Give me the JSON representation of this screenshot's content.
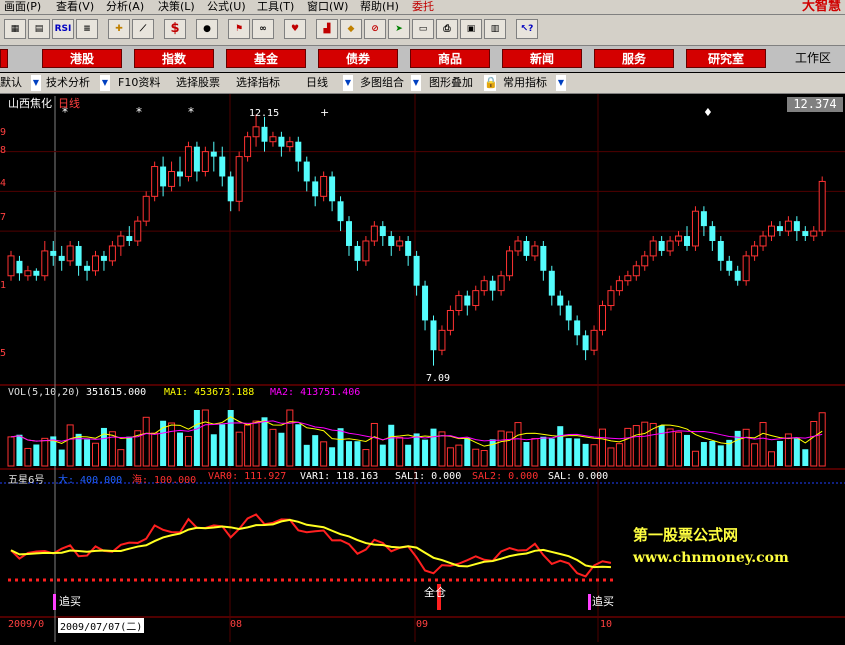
{
  "menu": [
    {
      "label": "画面(P)"
    },
    {
      "label": "查看(V)"
    },
    {
      "label": "分析(A)"
    },
    {
      "label": "决策(L)"
    },
    {
      "label": "公式(U)"
    },
    {
      "label": "工具(T)"
    },
    {
      "label": "窗口(W)"
    },
    {
      "label": "帮助(H)"
    },
    {
      "label": "委托"
    }
  ],
  "brand": "大智慧",
  "toolbar": {
    "rsi_label": "RSI",
    "dollar_label": "$"
  },
  "nav": [
    {
      "label": "港股"
    },
    {
      "label": "指数"
    },
    {
      "label": "基金"
    },
    {
      "label": "债券"
    },
    {
      "label": "商品"
    },
    {
      "label": "新闻"
    },
    {
      "label": "服务"
    },
    {
      "label": "研究室"
    }
  ],
  "workarea": "工作区",
  "subnav": [
    {
      "label": "默认"
    },
    {
      "label": "技术分析"
    },
    {
      "label": "F10资料"
    },
    {
      "label": "选择股票"
    },
    {
      "label": "选择指标"
    },
    {
      "label": "日线"
    },
    {
      "label": "多图组合"
    },
    {
      "label": "图形叠加"
    },
    {
      "label": "常用指标"
    }
  ],
  "colors": {
    "up": "#ff3232",
    "down": "#54fcfc",
    "accent": "#d40000",
    "ma1": "#ffff00",
    "ma2": "#ff00ff"
  },
  "stock": {
    "name": "山西焦化",
    "period": "日线",
    "current_price": "12.374"
  },
  "price_axis": [
    "9",
    "8",
    "4",
    "7",
    "1",
    "5"
  ],
  "high_label": "12.15",
  "low_label": "7.09",
  "vol_header": {
    "title": "VOL(5,10,20)",
    "value": "351615.000",
    "ma1": "MA1: 453673.188",
    "ma2": "MA2: 413751.406"
  },
  "ind_header": {
    "title": "五星6号",
    "big": "大: 400.000",
    "sea": "海: 100.000",
    "var0": "VAR0: 111.927",
    "var1": "VAR1: 118.163",
    "sal1": "SAL1: 0.000",
    "sal2": "SAL2: 0.000",
    "sal": "SAL: 0.000"
  },
  "signals": [
    "追买",
    "全仓",
    "追买"
  ],
  "watermark": {
    "line1": "第一股票公式网",
    "line2": "www.chnmoney.com"
  },
  "date_axis": {
    "left": "2009/0",
    "cursor": "2009/07/07(二)",
    "ticks": [
      "08",
      "09",
      "10"
    ]
  },
  "chart_data": {
    "type": "candlestick",
    "high": 12.15,
    "low": 7.09,
    "current": 12.374,
    "candles": [
      [
        8.9,
        9.3,
        8.8,
        9.4
      ],
      [
        9.2,
        8.95,
        8.8,
        9.3
      ],
      [
        8.9,
        9.0,
        8.8,
        9.1
      ],
      [
        9.0,
        8.9,
        8.8,
        9.05
      ],
      [
        8.9,
        9.4,
        8.8,
        9.6
      ],
      [
        9.4,
        9.3,
        9.1,
        9.6
      ],
      [
        9.3,
        9.2,
        9.0,
        9.5
      ],
      [
        9.2,
        9.5,
        9.1,
        9.6
      ],
      [
        9.5,
        9.1,
        8.9,
        9.6
      ],
      [
        9.1,
        9.0,
        8.8,
        9.2
      ],
      [
        9.0,
        9.3,
        8.9,
        9.4
      ],
      [
        9.3,
        9.2,
        9.0,
        9.4
      ],
      [
        9.2,
        9.5,
        9.1,
        9.6
      ],
      [
        9.5,
        9.7,
        9.3,
        9.8
      ],
      [
        9.7,
        9.6,
        9.5,
        9.9
      ],
      [
        9.6,
        10.0,
        9.5,
        10.1
      ],
      [
        10.0,
        10.5,
        9.9,
        10.6
      ],
      [
        10.5,
        11.1,
        10.4,
        11.2
      ],
      [
        11.1,
        10.7,
        10.5,
        11.3
      ],
      [
        10.7,
        11.0,
        10.6,
        11.2
      ],
      [
        11.0,
        10.9,
        10.7,
        11.3
      ],
      [
        10.9,
        11.5,
        10.8,
        11.6
      ],
      [
        11.5,
        11.0,
        10.8,
        11.6
      ],
      [
        11.0,
        11.4,
        10.9,
        11.5
      ],
      [
        11.4,
        11.3,
        11.0,
        11.6
      ],
      [
        11.3,
        10.9,
        10.7,
        11.5
      ],
      [
        10.9,
        10.4,
        10.2,
        11.0
      ],
      [
        10.4,
        11.3,
        10.2,
        11.4
      ],
      [
        11.3,
        11.7,
        11.2,
        11.8
      ],
      [
        11.7,
        11.9,
        11.5,
        12.15
      ],
      [
        11.9,
        11.6,
        11.4,
        12.1
      ],
      [
        11.6,
        11.7,
        11.5,
        11.8
      ],
      [
        11.7,
        11.5,
        11.3,
        11.8
      ],
      [
        11.5,
        11.6,
        11.4,
        11.7
      ],
      [
        11.6,
        11.2,
        11.0,
        11.7
      ],
      [
        11.2,
        10.8,
        10.6,
        11.3
      ],
      [
        10.8,
        10.5,
        10.3,
        10.9
      ],
      [
        10.5,
        10.9,
        10.4,
        11.0
      ],
      [
        10.9,
        10.4,
        10.2,
        11.0
      ],
      [
        10.4,
        10.0,
        9.8,
        10.5
      ],
      [
        10.0,
        9.5,
        9.3,
        10.1
      ],
      [
        9.5,
        9.2,
        9.0,
        9.6
      ],
      [
        9.2,
        9.6,
        9.1,
        9.7
      ],
      [
        9.6,
        9.9,
        9.5,
        10.0
      ],
      [
        9.9,
        9.7,
        9.5,
        10.0
      ],
      [
        9.7,
        9.5,
        9.3,
        9.8
      ],
      [
        9.5,
        9.6,
        9.4,
        9.7
      ],
      [
        9.6,
        9.3,
        9.1,
        9.7
      ],
      [
        9.3,
        8.7,
        8.5,
        9.4
      ],
      [
        8.7,
        8.0,
        7.8,
        8.8
      ],
      [
        8.0,
        7.4,
        7.09,
        8.1
      ],
      [
        7.4,
        7.8,
        7.3,
        7.9
      ],
      [
        7.8,
        8.2,
        7.7,
        8.3
      ],
      [
        8.2,
        8.5,
        8.1,
        8.6
      ],
      [
        8.5,
        8.3,
        8.1,
        8.6
      ],
      [
        8.3,
        8.6,
        8.2,
        8.7
      ],
      [
        8.6,
        8.8,
        8.5,
        8.9
      ],
      [
        8.8,
        8.6,
        8.4,
        8.9
      ],
      [
        8.6,
        8.9,
        8.5,
        9.0
      ],
      [
        8.9,
        9.4,
        8.8,
        9.5
      ],
      [
        9.4,
        9.6,
        9.3,
        9.7
      ],
      [
        9.6,
        9.3,
        9.2,
        9.7
      ],
      [
        9.3,
        9.5,
        9.2,
        9.6
      ],
      [
        9.5,
        9.0,
        8.8,
        9.6
      ],
      [
        9.0,
        8.5,
        8.3,
        9.1
      ],
      [
        8.5,
        8.3,
        8.1,
        8.6
      ],
      [
        8.3,
        8.0,
        7.8,
        8.4
      ],
      [
        8.0,
        7.7,
        7.5,
        8.1
      ],
      [
        7.7,
        7.4,
        7.2,
        7.8
      ],
      [
        7.4,
        7.8,
        7.3,
        7.9
      ],
      [
        7.8,
        8.3,
        7.7,
        8.4
      ],
      [
        8.3,
        8.6,
        8.2,
        8.7
      ],
      [
        8.6,
        8.8,
        8.5,
        8.9
      ],
      [
        8.8,
        8.9,
        8.7,
        9.0
      ],
      [
        8.9,
        9.1,
        8.8,
        9.2
      ],
      [
        9.1,
        9.3,
        9.0,
        9.4
      ],
      [
        9.3,
        9.6,
        9.2,
        9.7
      ],
      [
        9.6,
        9.4,
        9.3,
        9.7
      ],
      [
        9.4,
        9.6,
        9.3,
        9.7
      ],
      [
        9.6,
        9.7,
        9.5,
        9.8
      ],
      [
        9.7,
        9.5,
        9.4,
        9.9
      ],
      [
        9.5,
        10.2,
        9.4,
        10.3
      ],
      [
        10.2,
        9.9,
        9.7,
        10.3
      ],
      [
        9.9,
        9.6,
        9.4,
        10.0
      ],
      [
        9.6,
        9.2,
        9.0,
        9.7
      ],
      [
        9.2,
        9.0,
        8.9,
        9.3
      ],
      [
        9.0,
        8.8,
        8.7,
        9.1
      ],
      [
        8.8,
        9.3,
        8.7,
        9.4
      ],
      [
        9.3,
        9.5,
        9.2,
        9.6
      ],
      [
        9.5,
        9.7,
        9.4,
        9.8
      ],
      [
        9.7,
        9.9,
        9.6,
        10.0
      ],
      [
        9.9,
        9.8,
        9.7,
        10.0
      ],
      [
        9.8,
        10.0,
        9.7,
        10.1
      ],
      [
        10.0,
        9.8,
        9.6,
        10.1
      ],
      [
        9.8,
        9.7,
        9.6,
        9.9
      ],
      [
        9.7,
        9.8,
        9.6,
        9.9
      ],
      [
        9.8,
        10.8,
        9.7,
        10.9
      ]
    ]
  }
}
